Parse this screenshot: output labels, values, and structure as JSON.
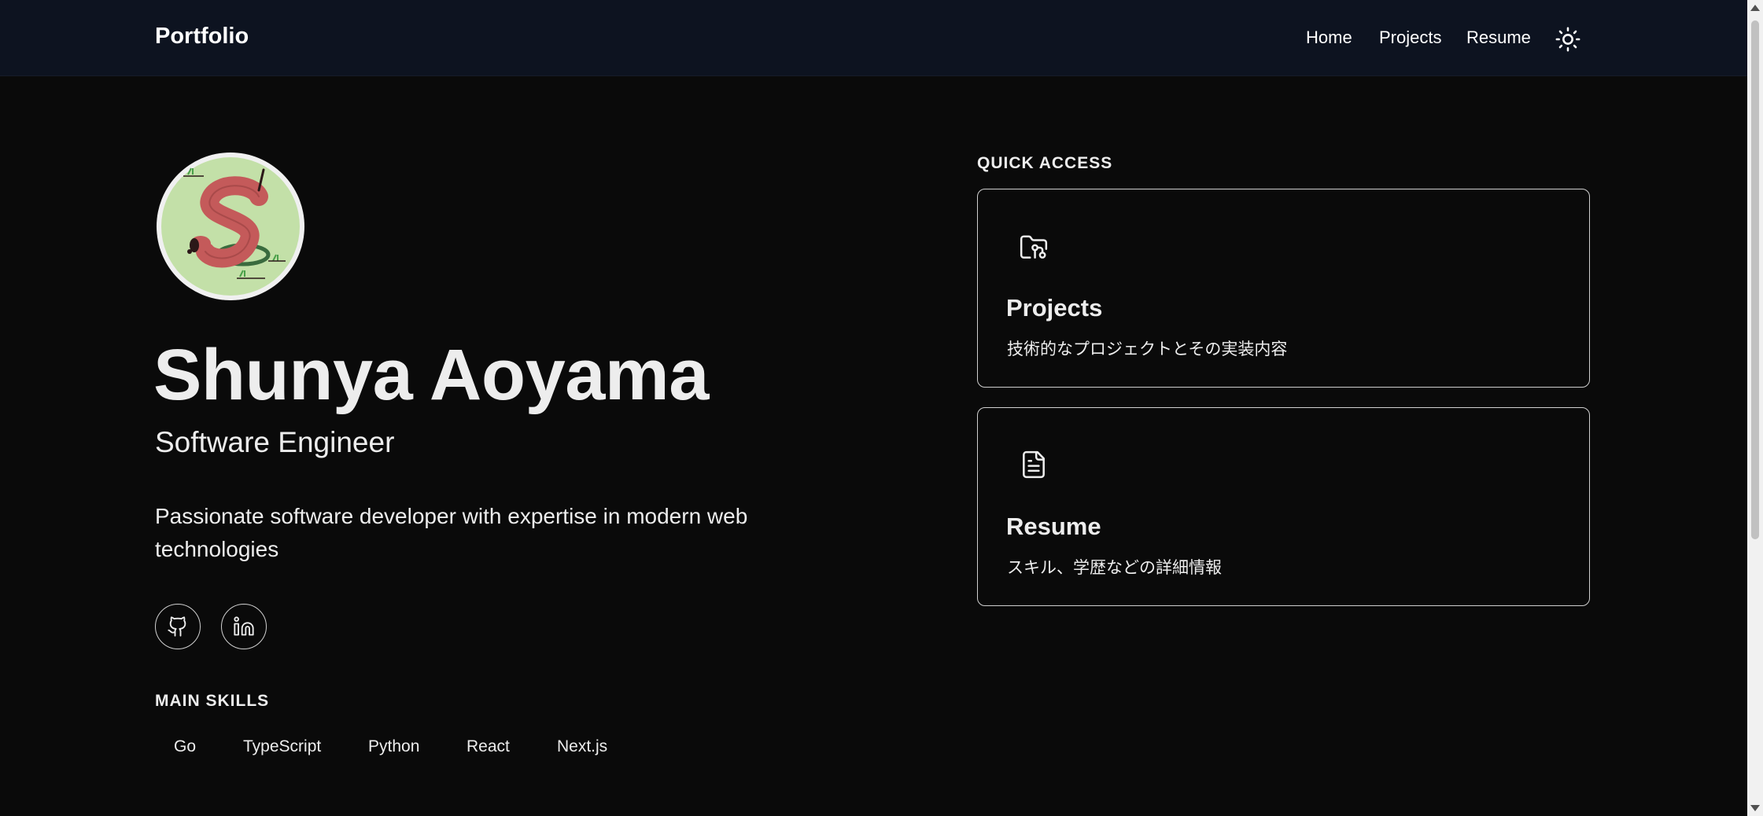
{
  "navbar": {
    "brand": "Portfolio",
    "links": [
      "Home",
      "Projects",
      "Resume"
    ],
    "theme_toggle_icon": "sun-icon"
  },
  "profile": {
    "name": "Shunya Aoyama",
    "role": "Software Engineer",
    "bio": "Passionate software developer with expertise in modern web technologies",
    "avatar_icon": "dachshund-s-logo"
  },
  "social": [
    {
      "icon": "github-icon"
    },
    {
      "icon": "linkedin-icon"
    }
  ],
  "skills": {
    "label": "MAIN SKILLS",
    "items": [
      "Go",
      "TypeScript",
      "Python",
      "React",
      "Next.js"
    ]
  },
  "quick_access": {
    "label": "QUICK ACCESS",
    "cards": [
      {
        "title": "Projects",
        "description": "技術的なプロジェクトとその実装内容",
        "icon": "folder-git-icon"
      },
      {
        "title": "Resume",
        "description": "スキル、学歴などの詳細情報",
        "icon": "document-icon"
      }
    ]
  },
  "colors": {
    "background": "#0a0a0a",
    "navbar": "#0d1320",
    "text": "#ededed",
    "avatar_bg": "#c3e0a8",
    "avatar_letter": "#c45a5a"
  }
}
